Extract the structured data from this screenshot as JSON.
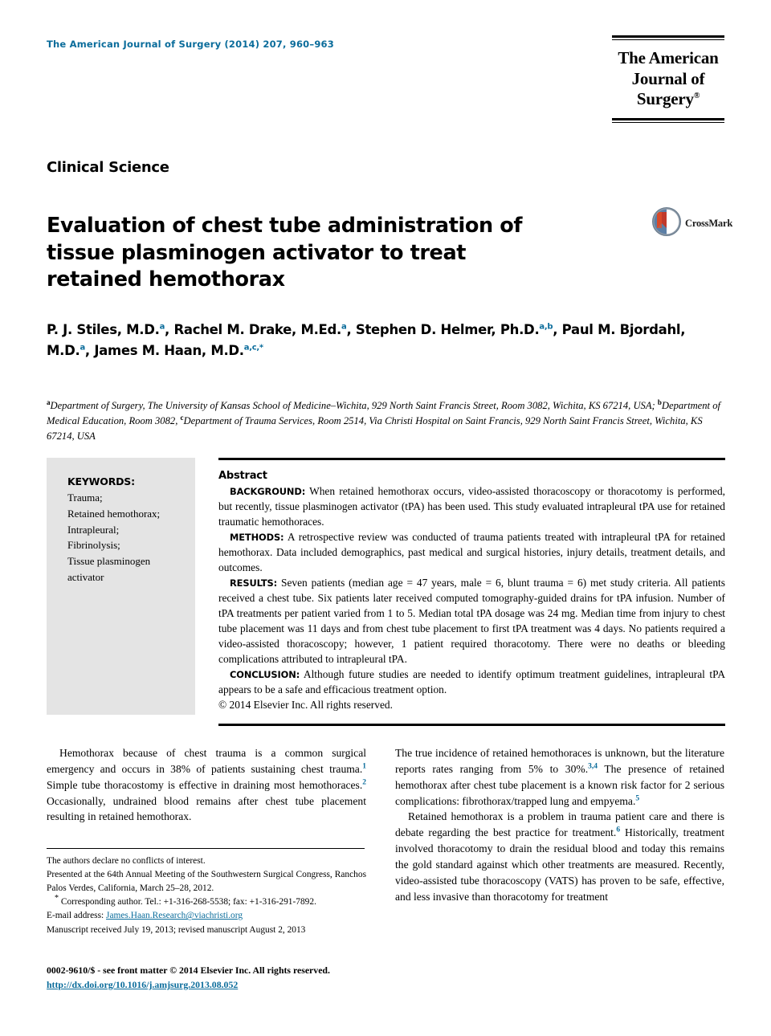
{
  "colors": {
    "accent": "#0a6c9b",
    "keywords_box_bg": "#e4e4e4",
    "rule": "#000000",
    "crossmark_red": "#c0392b",
    "crossmark_blue": "#5b7fa6"
  },
  "header": {
    "journal_citation": "The American Journal of Surgery (2014) 207, 960–963",
    "logo_line1": "The American",
    "logo_line2": "Journal of Surgery",
    "logo_tm": "®"
  },
  "section_label": "Clinical Science",
  "title": "Evaluation of chest tube administration of tissue plasminogen activator to treat retained hemothorax",
  "crossmark": {
    "label": "CrossMark",
    "icon": "crossmark-icon"
  },
  "authors": [
    {
      "name": "P. J. Stiles, M.D.",
      "sup": "a",
      "sep": ", "
    },
    {
      "name": "Rachel M. Drake, M.Ed.",
      "sup": "a",
      "sep": ", "
    },
    {
      "name": "Stephen D. Helmer, Ph.D.",
      "sup": "a,b",
      "sep": ", "
    },
    {
      "name": "Paul M. Bjordahl, M.D.",
      "sup": "a",
      "sep": ", "
    },
    {
      "name": "James M. Haan, M.D.",
      "sup": "a,c,*",
      "sep": ""
    }
  ],
  "affiliations": [
    {
      "sup": "a",
      "text": "Department of Surgery, The University of Kansas School of Medicine–Wichita, 929 North Saint Francis Street, Room 3082, Wichita, KS 67214, USA; "
    },
    {
      "sup": "b",
      "text": "Department of Medical Education, Room 3082, "
    },
    {
      "sup": "c",
      "text": "Department of Trauma Services, Room 2514, Via Christi Hospital on Saint Francis, 929 North Saint Francis Street, Wichita, KS 67214, USA"
    }
  ],
  "keywords": {
    "title": "KEYWORDS:",
    "items": [
      "Trauma;",
      "Retained hemothorax;",
      "Intrapleural;",
      "Fibrinolysis;",
      "Tissue plasminogen",
      "activator"
    ]
  },
  "abstract": {
    "heading": "Abstract",
    "sections": [
      {
        "label": "BACKGROUND:",
        "text": "When retained hemothorax occurs, video-assisted thoracoscopy or thoracotomy is performed, but recently, tissue plasminogen activator (tPA) has been used. This study evaluated intrapleural tPA use for retained traumatic hemothoraces."
      },
      {
        "label": "METHODS:",
        "text": "A retrospective review was conducted of trauma patients treated with intrapleural tPA for retained hemothorax. Data included demographics, past medical and surgical histories, injury details, treatment details, and outcomes."
      },
      {
        "label": "RESULTS:",
        "text": "Seven patients (median age = 47 years, male = 6, blunt trauma = 6) met study criteria. All patients received a chest tube. Six patients later received computed tomography-guided drains for tPA infusion. Number of tPA treatments per patient varied from 1 to 5. Median total tPA dosage was 24 mg. Median time from injury to chest tube placement was 11 days and from chest tube placement to first tPA treatment was 4 days. No patients required a video-assisted thoracoscopy; however, 1 patient required thoracotomy. There were no deaths or bleeding complications attributed to intrapleural tPA."
      },
      {
        "label": "CONCLUSION:",
        "text": "Although future studies are needed to identify optimum treatment guidelines, intrapleural tPA appears to be a safe and efficacious treatment option."
      }
    ],
    "copyright": "© 2014 Elsevier Inc. All rights reserved."
  },
  "body": {
    "left_column": [
      {
        "indent": true,
        "runs": [
          {
            "t": "Hemothorax because of chest trauma is a common surgical emergency and occurs in 38% of patients sustaining chest trauma."
          },
          {
            "t": "1",
            "ref": true
          },
          {
            "t": " Simple tube thoracostomy is effective in draining most hemothoraces."
          },
          {
            "t": "2",
            "ref": true
          },
          {
            "t": " Occasionally, undrained blood remains after chest tube placement resulting in retained hemothorax."
          }
        ]
      }
    ],
    "right_column": [
      {
        "indent": false,
        "runs": [
          {
            "t": "The true incidence of retained hemothoraces is unknown, but the literature reports rates ranging from 5% to 30%."
          },
          {
            "t": "3,4",
            "ref": true
          },
          {
            "t": " The presence of retained hemothorax after chest tube placement is a known risk factor for 2 serious complications: fibrothorax/trapped lung and empyema."
          },
          {
            "t": "5",
            "ref": true
          }
        ]
      },
      {
        "indent": true,
        "runs": [
          {
            "t": "Retained hemothorax is a problem in trauma patient care and there is debate regarding the best practice for treatment."
          },
          {
            "t": "6",
            "ref": true
          },
          {
            "t": " Historically, treatment involved thoracotomy to drain the residual blood and today this remains the gold standard against which other treatments are measured. Recently, video-assisted tube thoracoscopy (VATS) has proven to be safe, effective, and less invasive than thoracotomy for treatment"
          }
        ]
      }
    ]
  },
  "footnotes": {
    "conflicts": "The authors declare no conflicts of interest.",
    "presented": "Presented at the 64th Annual Meeting of the Southwestern Surgical Congress, Ranchos Palos Verdes, California, March 25–28, 2012.",
    "corresponding_marker": "*",
    "corresponding": " Corresponding author. Tel.: +1-316-268-5538; fax: +1-316-291-7892.",
    "email_label": "E-mail address: ",
    "email": "James.Haan.Research@viachristi.org",
    "manuscript": "Manuscript received July 19, 2013; revised manuscript August 2, 2013"
  },
  "footer": {
    "front_matter": "0002-9610/$ - see front matter © 2014 Elsevier Inc. All rights reserved.",
    "doi": "http://dx.doi.org/10.1016/j.amjsurg.2013.08.052"
  }
}
